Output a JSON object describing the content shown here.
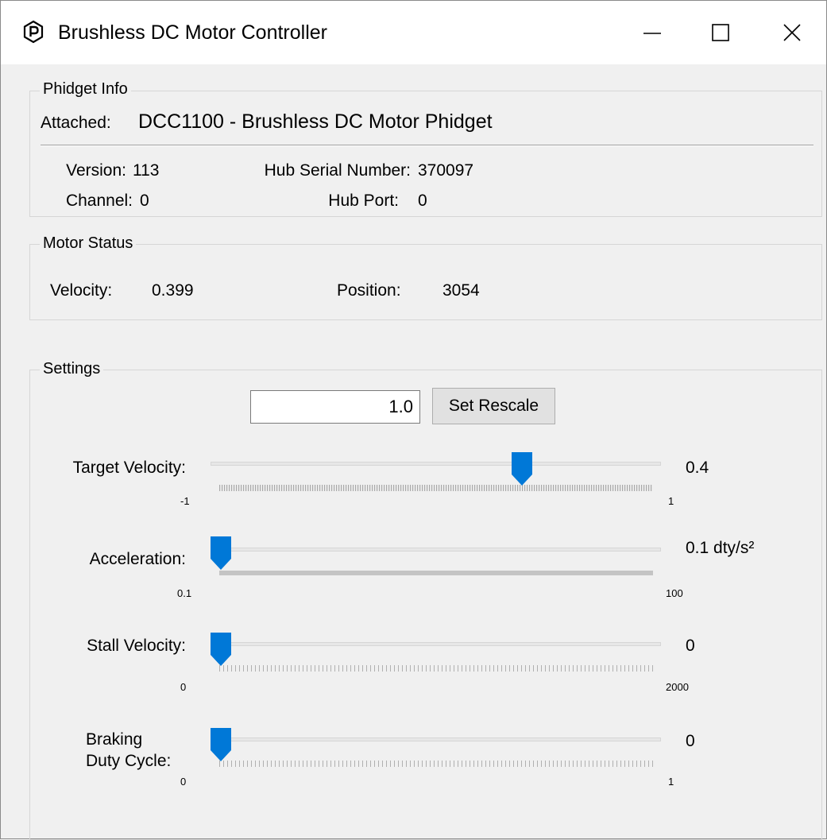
{
  "window": {
    "title": "Brushless DC Motor Controller",
    "icon": "phidgets-logo-icon",
    "controls": [
      "minimize-icon",
      "maximize-icon",
      "close-icon"
    ]
  },
  "phidget_info": {
    "group_title": "Phidget Info",
    "attached_label": "Attached:",
    "attached_value": "DCC1100 - Brushless DC Motor Phidget",
    "version_label": "Version:",
    "version_value": "113",
    "hub_serial_label": "Hub Serial Number:",
    "hub_serial_value": "370097",
    "channel_label": "Channel:",
    "channel_value": "0",
    "hub_port_label": "Hub Port:",
    "hub_port_value": "0"
  },
  "motor_status": {
    "group_title": "Motor Status",
    "velocity_label": "Velocity:",
    "velocity_value": "0.399",
    "position_label": "Position:",
    "position_value": "3054"
  },
  "settings": {
    "group_title": "Settings",
    "rescale_value": "1.0",
    "rescale_button": "Set Rescale",
    "sliders": [
      {
        "label": "Target Velocity:",
        "value_text": "0.4",
        "min": -1,
        "max": 1,
        "min_label": "-1",
        "max_label": "1",
        "value": 0.4
      },
      {
        "label": "Acceleration:",
        "value_text": "0.1 dty/s²",
        "min": 0.1,
        "max": 100,
        "min_label": "0.1",
        "max_label": "100",
        "value": 0.1
      },
      {
        "label": "Stall Velocity:",
        "value_text": "0",
        "min": 0,
        "max": 2000,
        "min_label": "0",
        "max_label": "2000",
        "value": 0
      },
      {
        "label_line1": "Braking",
        "label_line2": "Duty Cycle:",
        "value_text": "0",
        "min": 0,
        "max": 1,
        "min_label": "0",
        "max_label": "1",
        "value": 0
      }
    ]
  },
  "colors": {
    "thumb": "#0078d7",
    "window_bg": "#f0f0f0",
    "titlebar_bg": "#ffffff"
  }
}
